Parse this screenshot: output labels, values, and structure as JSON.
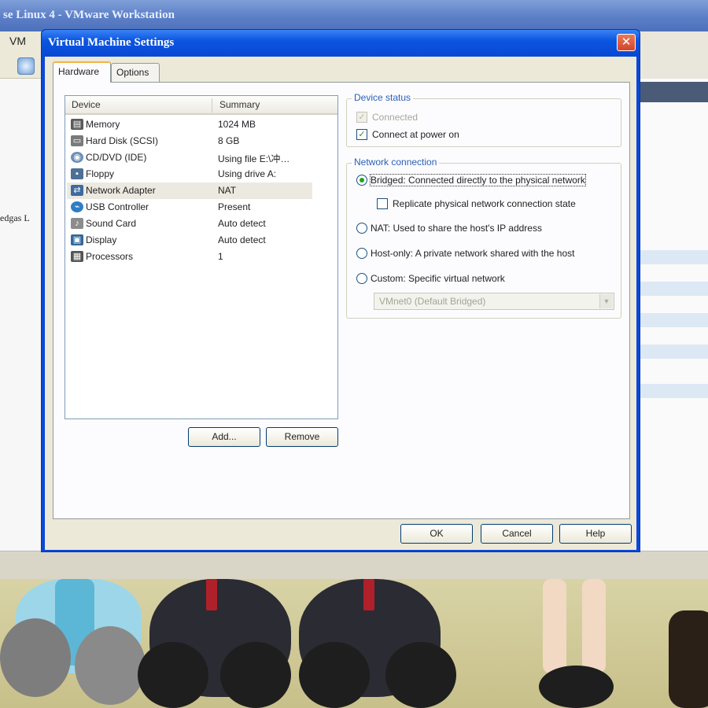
{
  "background_window": {
    "title": "se Linux 4 - VMware Workstation",
    "menu_vm": "VM",
    "sidebar_item": "edgas L"
  },
  "dialog": {
    "title": "Virtual Machine Settings",
    "close_label": "✕",
    "tabs": [
      {
        "label": "Hardware",
        "active": true
      },
      {
        "label": "Options",
        "active": false
      }
    ],
    "device_list": {
      "columns": [
        "Device",
        "Summary"
      ],
      "rows": [
        {
          "icon": "memory-icon",
          "device": "Memory",
          "summary": "1024 MB"
        },
        {
          "icon": "hard-disk-icon",
          "device": "Hard Disk (SCSI)",
          "summary": "8 GB"
        },
        {
          "icon": "cd-dvd-icon",
          "device": "CD/DVD (IDE)",
          "summary": "Using file E:\\冲…"
        },
        {
          "icon": "floppy-icon",
          "device": "Floppy",
          "summary": "Using drive A:"
        },
        {
          "icon": "network-adapter-icon",
          "device": "Network Adapter",
          "summary": "NAT",
          "selected": true
        },
        {
          "icon": "usb-icon",
          "device": "USB Controller",
          "summary": "Present"
        },
        {
          "icon": "sound-card-icon",
          "device": "Sound Card",
          "summary": "Auto detect"
        },
        {
          "icon": "display-icon",
          "device": "Display",
          "summary": "Auto detect"
        },
        {
          "icon": "processor-icon",
          "device": "Processors",
          "summary": "1"
        }
      ]
    },
    "add_label": "Add...",
    "remove_label": "Remove",
    "device_status": {
      "title": "Device status",
      "connected": {
        "label": "Connected",
        "checked": true,
        "disabled": true
      },
      "connect_at_power_on": {
        "label": "Connect at power on",
        "checked": true
      }
    },
    "network_connection": {
      "title": "Network connection",
      "options": [
        {
          "label": "Bridged: Connected directly to the physical network",
          "selected": true
        },
        {
          "label": "NAT: Used to share the host's IP address",
          "selected": false
        },
        {
          "label": "Host-only: A private network shared with the host",
          "selected": false
        },
        {
          "label": "Custom: Specific virtual network",
          "selected": false
        }
      ],
      "replicate_label": "Replicate physical network connection state",
      "replicate_checked": false,
      "custom_select_value": "VMnet0 (Default Bridged)"
    },
    "ok_label": "OK",
    "cancel_label": "Cancel",
    "help_label": "Help"
  },
  "colors": {
    "title_blue": "#0b55e0",
    "accent_green": "#21a121",
    "group_title": "#2c5fb5"
  }
}
